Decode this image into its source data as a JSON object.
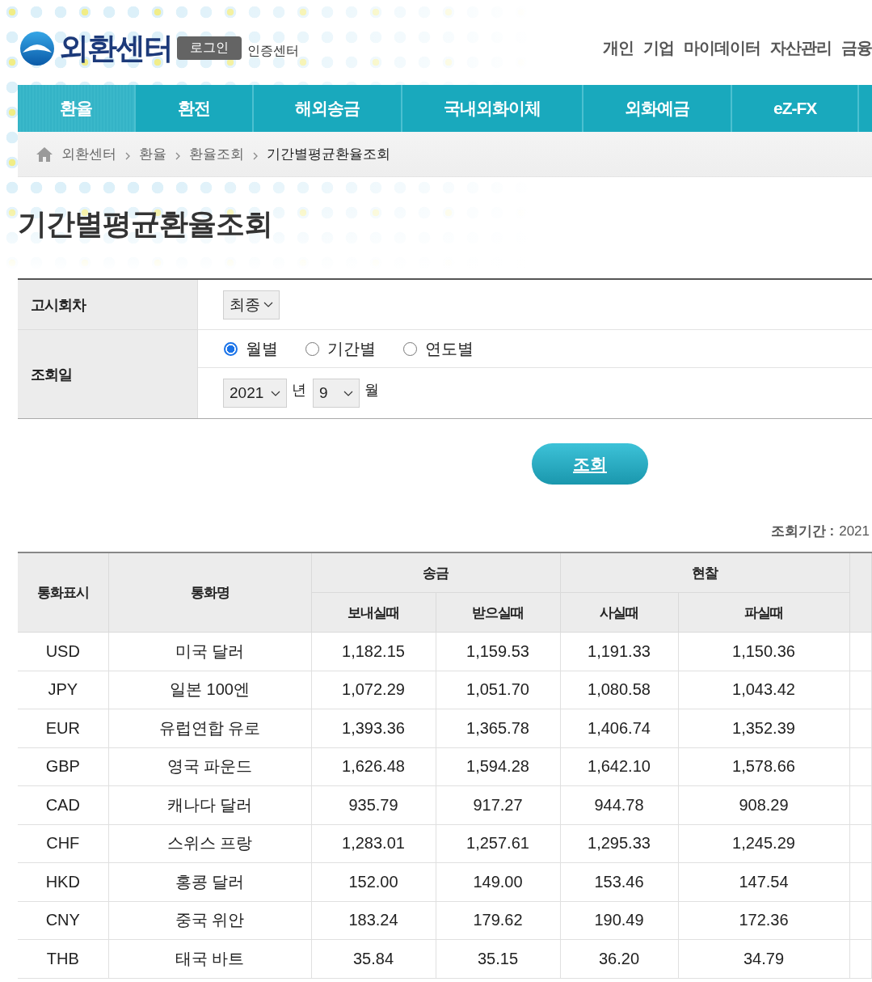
{
  "header": {
    "logo_text": "외환센터",
    "login_button": "로그인",
    "cert_link": "인증센터",
    "top_menu": [
      "개인",
      "기업",
      "마이데이터",
      "자산관리",
      "금융"
    ]
  },
  "main_nav": [
    {
      "label": "환율",
      "selected": true
    },
    {
      "label": "환전",
      "selected": false
    },
    {
      "label": "해외송금",
      "selected": false
    },
    {
      "label": "국내외화이체",
      "selected": false
    },
    {
      "label": "외화예금",
      "selected": false
    },
    {
      "label": "eZ-FX",
      "selected": false
    }
  ],
  "breadcrumb": [
    {
      "label": "외환센터",
      "current": false
    },
    {
      "label": "환율",
      "current": false
    },
    {
      "label": "환율조회",
      "current": false
    },
    {
      "label": "기간별평균환율조회",
      "current": true
    }
  ],
  "page_title": "기간별평균환율조회",
  "search_form": {
    "notice_round": {
      "label": "고시회차",
      "value": "최종"
    },
    "query_date": {
      "label": "조회일",
      "modes": [
        {
          "label": "월별",
          "selected": true
        },
        {
          "label": "기간별",
          "selected": false
        },
        {
          "label": "연도별",
          "selected": false
        }
      ],
      "year": "2021",
      "year_unit": "년",
      "month": "9",
      "month_unit": "월"
    },
    "submit_button": "조회"
  },
  "period": {
    "label": "조회기간 :",
    "value": "2021"
  },
  "table": {
    "columns": [
      "통화표시",
      "통화명"
    ],
    "groups": [
      {
        "label": "송금",
        "columns": [
          "보내실때",
          "받으실때"
        ]
      },
      {
        "label": "현찰",
        "columns": [
          "사실때",
          "파실때"
        ]
      }
    ],
    "rows": [
      [
        "USD",
        "미국 달러",
        "1,182.15",
        "1,159.53",
        "1,191.33",
        "1,150.36"
      ],
      [
        "JPY",
        "일본 100엔",
        "1,072.29",
        "1,051.70",
        "1,080.58",
        "1,043.42"
      ],
      [
        "EUR",
        "유럽연합 유로",
        "1,393.36",
        "1,365.78",
        "1,406.74",
        "1,352.39"
      ],
      [
        "GBP",
        "영국 파운드",
        "1,626.48",
        "1,594.28",
        "1,642.10",
        "1,578.66"
      ],
      [
        "CAD",
        "캐나다 달러",
        "935.79",
        "917.27",
        "944.78",
        "908.29"
      ],
      [
        "CHF",
        "스위스 프랑",
        "1,283.01",
        "1,257.61",
        "1,295.33",
        "1,245.29"
      ],
      [
        "HKD",
        "홍콩 달러",
        "152.00",
        "149.00",
        "153.46",
        "147.54"
      ],
      [
        "CNY",
        "중국 위안",
        "183.24",
        "179.62",
        "190.49",
        "172.36"
      ],
      [
        "THB",
        "태국 바트",
        "35.84",
        "35.15",
        "36.20",
        "34.79"
      ]
    ]
  }
}
